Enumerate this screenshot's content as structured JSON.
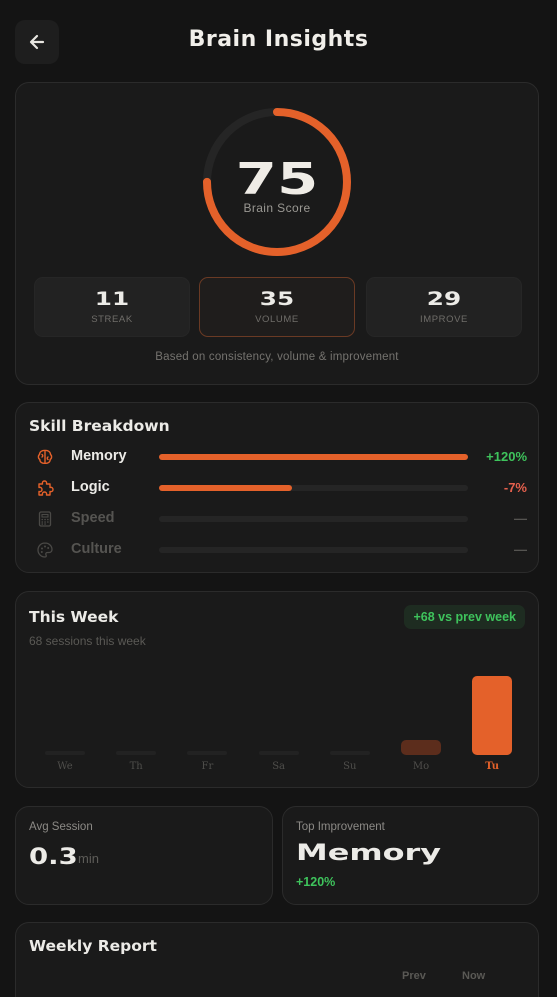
{
  "header": {
    "title": "Brain Insights",
    "back_icon": "arrow-left-icon"
  },
  "score": {
    "value": "75",
    "label": "Brain Score",
    "progress": 0.75,
    "accent": "#e4612a",
    "stats": [
      {
        "value": "11",
        "label": "STREAK",
        "active": false
      },
      {
        "value": "35",
        "label": "VOLUME",
        "active": true
      },
      {
        "value": "29",
        "label": "IMPROVE",
        "active": false
      }
    ],
    "note": "Based on consistency, volume & improvement"
  },
  "skills": {
    "title": "Skill Breakdown",
    "items": [
      {
        "name": "Memory",
        "icon": "brain-icon",
        "level": 1.0,
        "delta": "+120%",
        "delta_color": "#3ec35c",
        "active": true
      },
      {
        "name": "Logic",
        "icon": "puzzle-icon",
        "level": 0.43,
        "delta": "-7%",
        "delta_color": "#e5604d",
        "active": true
      },
      {
        "name": "Speed",
        "icon": "calculator-icon",
        "level": 0,
        "delta": "—",
        "delta_color": "#555451",
        "active": false
      },
      {
        "name": "Culture",
        "icon": "palette-icon",
        "level": 0,
        "delta": "—",
        "delta_color": "#555451",
        "active": false
      }
    ]
  },
  "week": {
    "title": "This Week",
    "badge": "+68 vs prev week",
    "subtitle": "68 sessions this week",
    "days": [
      {
        "label": "We",
        "sessions": 0
      },
      {
        "label": "Th",
        "sessions": 0
      },
      {
        "label": "Fr",
        "sessions": 0
      },
      {
        "label": "Sa",
        "sessions": 0
      },
      {
        "label": "Su",
        "sessions": 0
      },
      {
        "label": "Mo",
        "sessions": 11
      },
      {
        "label": "Tu",
        "sessions": 57,
        "today": true
      }
    ]
  },
  "avg_session": {
    "label": "Avg Session",
    "value": "0.3",
    "unit": "min"
  },
  "top_improvement": {
    "label": "Top Improvement",
    "value": "Memory",
    "delta": "+120%"
  },
  "report": {
    "title": "Weekly Report",
    "col_prev": "Prev",
    "col_now": "Now"
  }
}
